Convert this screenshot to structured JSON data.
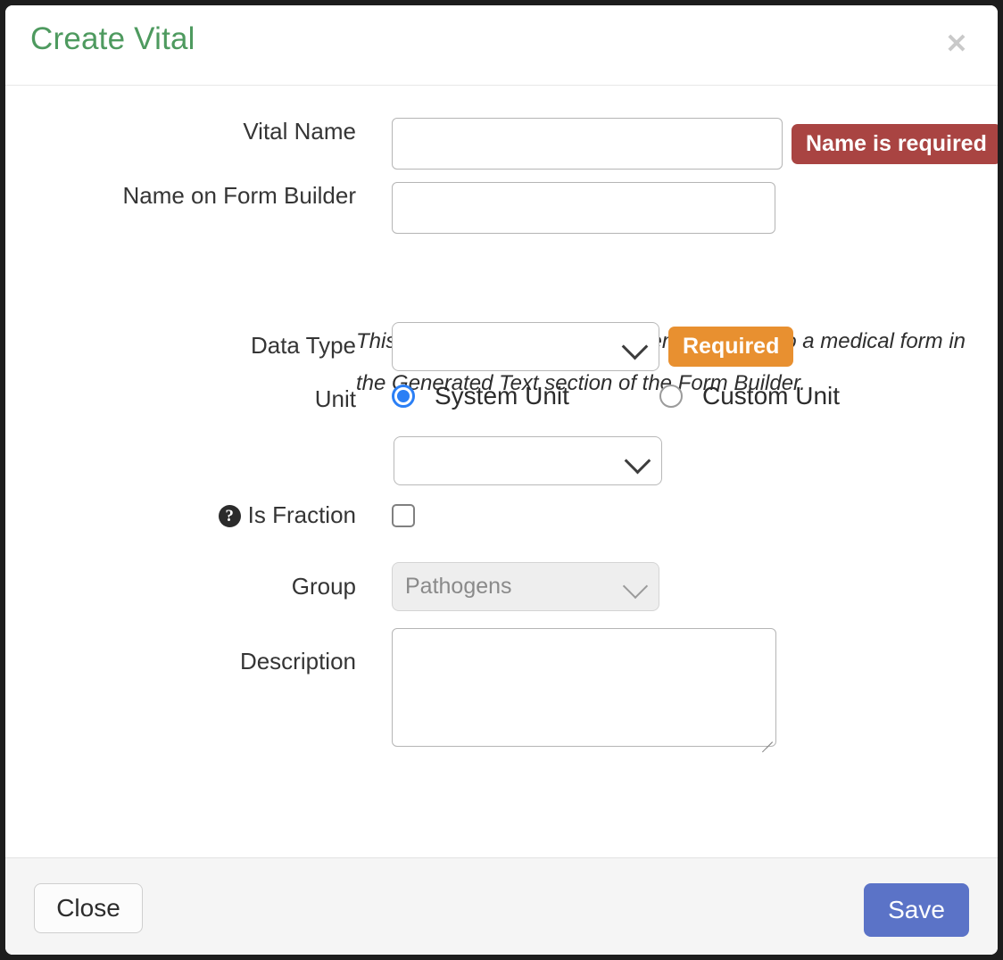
{
  "modal": {
    "title": "Create Vital",
    "close_icon": "close-icon",
    "close_icon_glyph": "✕",
    "title_color": "#4e9a5f"
  },
  "form": {
    "vital_name": {
      "label": "Vital Name",
      "value": "",
      "placeholder": "",
      "error_badge": "Name is required",
      "error_badge_color": "#a94442"
    },
    "name_on_form_builder": {
      "label": "Name on Form Builder",
      "value": "",
      "placeholder": "",
      "helper_text": "This is the name of the vital when you add it to a medical form in the Generated Text section of the Form Builder."
    },
    "data_type": {
      "label": "Data Type",
      "value": "",
      "required_badge": "Required",
      "required_badge_color": "#e89030",
      "chevron_icon": "chevron-down-icon"
    },
    "unit": {
      "label": "Unit",
      "options": [
        {
          "label": "System Unit",
          "selected": true
        },
        {
          "label": "Custom Unit",
          "selected": false
        }
      ],
      "select_value": "",
      "chevron_icon": "chevron-down-icon"
    },
    "is_fraction": {
      "label": "Is Fraction",
      "help_icon": "help-circle-icon",
      "help_icon_glyph": "?",
      "checked": false
    },
    "group": {
      "label": "Group",
      "value": "Pathogens",
      "disabled": true,
      "chevron_icon": "chevron-down-icon"
    },
    "description": {
      "label": "Description",
      "value": "",
      "placeholder": ""
    }
  },
  "footer": {
    "close_label": "Close",
    "save_label": "Save",
    "save_color": "#5b73c7"
  }
}
